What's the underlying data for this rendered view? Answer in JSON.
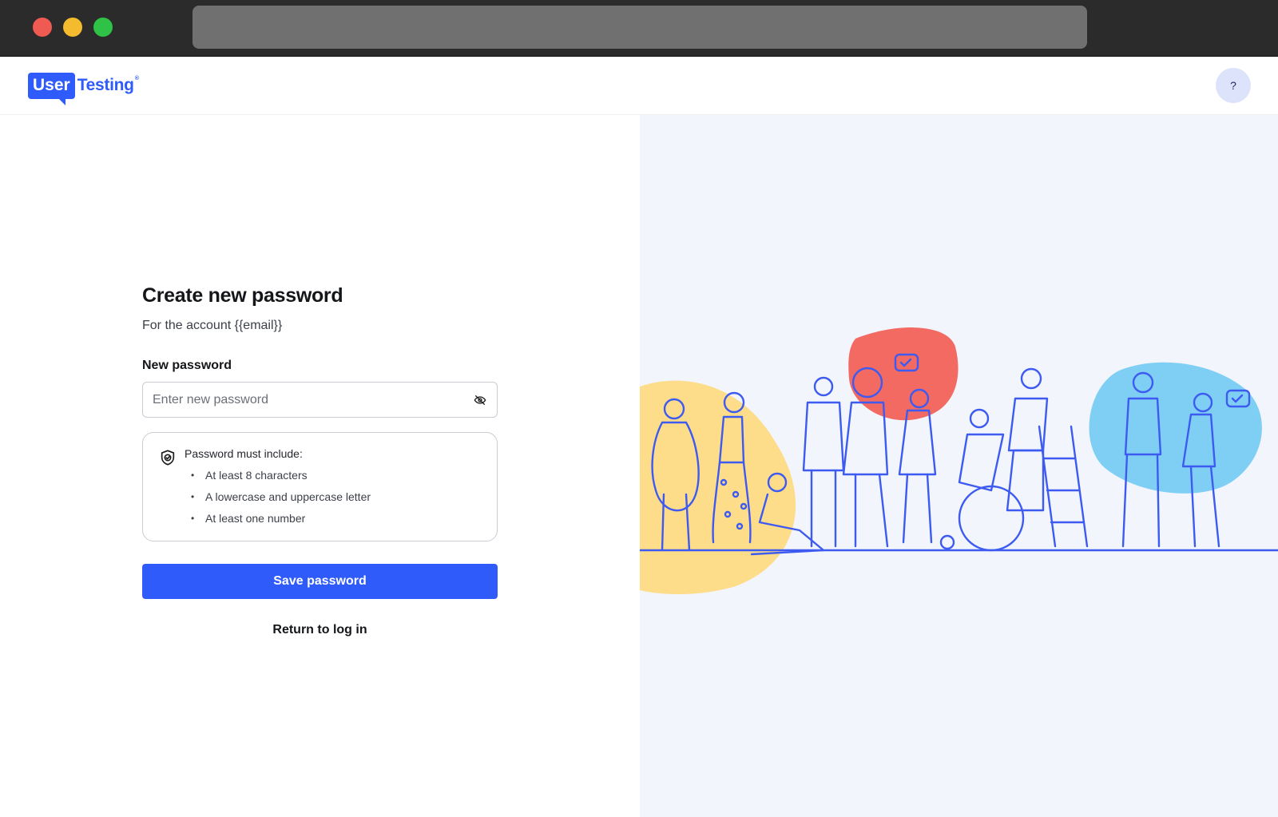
{
  "app": {
    "logo_word_1": "User",
    "logo_word_2": "Testing",
    "help_label": "?"
  },
  "form": {
    "title": "Create new password",
    "subtitle": "For the account {{email}}",
    "field_label": "New password",
    "password_placeholder": "Enter new password",
    "rules_title": "Password must include:",
    "rules": [
      "At least 8 characters",
      "A lowercase and uppercase letter",
      "At least one number"
    ],
    "save_label": "Save password",
    "return_label": "Return to log in"
  },
  "colors": {
    "accent": "#2f5bfa",
    "chrome": "#2b2b2b",
    "panel_bg": "#f2f5fb",
    "blob_yellow": "#fddc8a",
    "blob_red": "#f26a62",
    "blob_blue": "#7fcff5"
  },
  "icons": {
    "password_toggle": "eye-slash-icon",
    "rules": "shield-check-icon"
  }
}
